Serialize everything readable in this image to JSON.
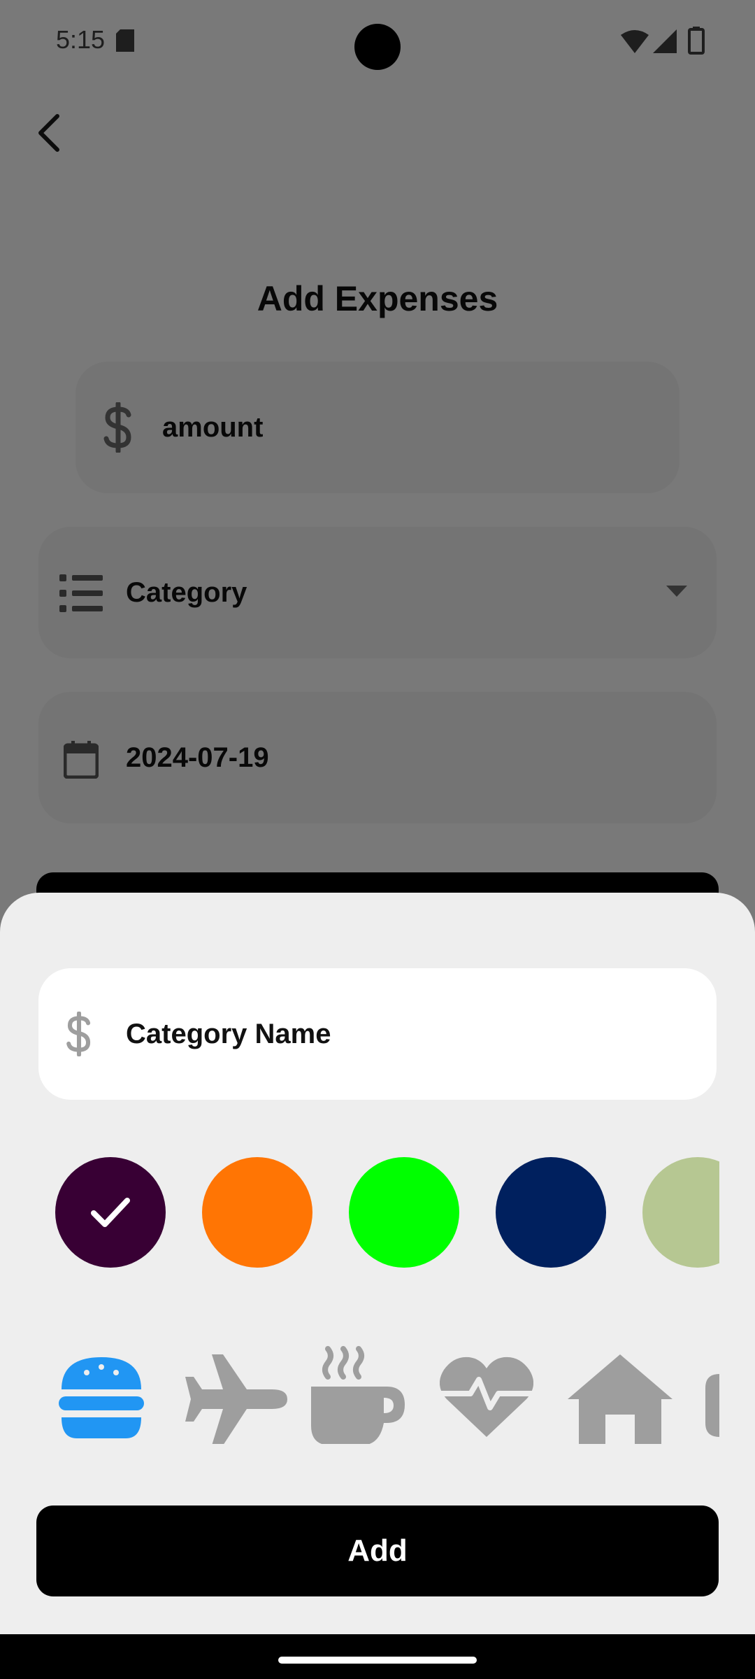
{
  "status_bar": {
    "time": "5:15"
  },
  "page": {
    "title": "Add Expenses",
    "amount_placeholder": "amount",
    "category_label": "Category",
    "date_value": "2024-07-19"
  },
  "sheet": {
    "category_name_placeholder": "Category Name",
    "colors": [
      "#380034",
      "#ff7504",
      "#00ff00",
      "#00205e",
      "#b6c792"
    ],
    "selected_color_index": 0,
    "icons": [
      "burger-icon",
      "airplane-icon",
      "coffee-cup-icon",
      "heartbeat-icon",
      "home-icon",
      "partial-icon"
    ],
    "selected_icon_index": 0,
    "selected_icon_color": "#2196f3",
    "icon_color": "#9e9e9e",
    "add_label": "Add"
  }
}
